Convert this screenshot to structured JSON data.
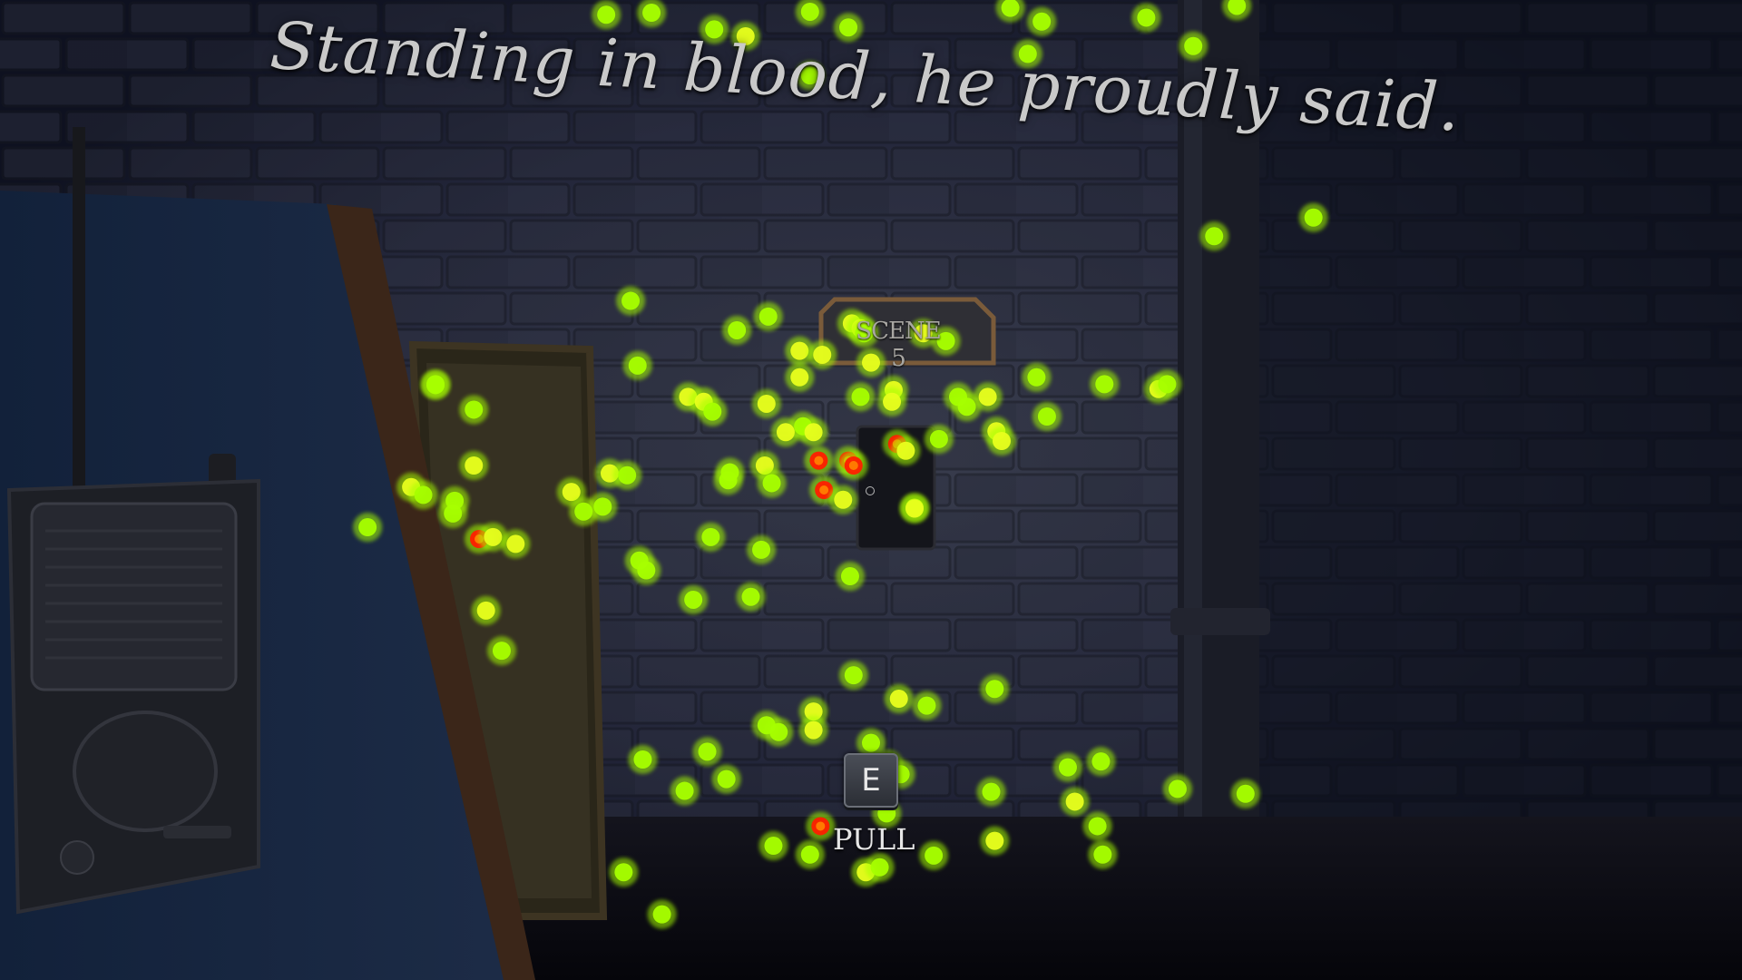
{
  "subtitle": "Standing in blood, he proudly said.",
  "sign": {
    "text": "SCENE 5"
  },
  "interaction_prompt": {
    "key": "E",
    "action": "PULL"
  },
  "heatmap": {
    "colors": {
      "low": "#a6ff00",
      "mid": "#e8ff1e",
      "high": "#ff1e00"
    },
    "points": [
      [
        0.348,
        0.015,
        0.5
      ],
      [
        0.374,
        0.013,
        0.5
      ],
      [
        0.41,
        0.03,
        0.5
      ],
      [
        0.428,
        0.037,
        0.6
      ],
      [
        0.465,
        0.012,
        0.5
      ],
      [
        0.487,
        0.028,
        0.5
      ],
      [
        0.465,
        0.077,
        0.5
      ],
      [
        0.58,
        0.008,
        0.5
      ],
      [
        0.598,
        0.022,
        0.5
      ],
      [
        0.658,
        0.018,
        0.5
      ],
      [
        0.685,
        0.047,
        0.5
      ],
      [
        0.71,
        0.006,
        0.5
      ],
      [
        0.59,
        0.055,
        0.5
      ],
      [
        0.697,
        0.241,
        0.5
      ],
      [
        0.754,
        0.222,
        0.5
      ],
      [
        0.362,
        0.307,
        0.5
      ],
      [
        0.423,
        0.337,
        0.5
      ],
      [
        0.441,
        0.323,
        0.5
      ],
      [
        0.366,
        0.373,
        0.5
      ],
      [
        0.25,
        0.392,
        0.5
      ],
      [
        0.272,
        0.418,
        0.5
      ],
      [
        0.459,
        0.358,
        0.6
      ],
      [
        0.459,
        0.385,
        0.6
      ],
      [
        0.472,
        0.362,
        0.6
      ],
      [
        0.489,
        0.33,
        0.6
      ],
      [
        0.494,
        0.335,
        0.6
      ],
      [
        0.496,
        0.34,
        0.5
      ],
      [
        0.5,
        0.37,
        0.6
      ],
      [
        0.513,
        0.398,
        0.7
      ],
      [
        0.53,
        0.34,
        0.6
      ],
      [
        0.543,
        0.348,
        0.5
      ],
      [
        0.512,
        0.41,
        0.6
      ],
      [
        0.494,
        0.405,
        0.5
      ],
      [
        0.395,
        0.405,
        0.6
      ],
      [
        0.404,
        0.41,
        0.6
      ],
      [
        0.409,
        0.42,
        0.5
      ],
      [
        0.44,
        0.412,
        0.6
      ],
      [
        0.461,
        0.435,
        0.5
      ],
      [
        0.418,
        0.49,
        0.5
      ],
      [
        0.439,
        0.475,
        0.6
      ],
      [
        0.451,
        0.441,
        0.6
      ],
      [
        0.467,
        0.441,
        0.7
      ],
      [
        0.47,
        0.47,
        0.9
      ],
      [
        0.473,
        0.5,
        0.8
      ],
      [
        0.487,
        0.47,
        0.9
      ],
      [
        0.49,
        0.475,
        0.8
      ],
      [
        0.484,
        0.51,
        0.6
      ],
      [
        0.515,
        0.453,
        0.8
      ],
      [
        0.52,
        0.46,
        0.6
      ],
      [
        0.525,
        0.518,
        0.6
      ],
      [
        0.539,
        0.448,
        0.5
      ],
      [
        0.55,
        0.405,
        0.5
      ],
      [
        0.555,
        0.415,
        0.5
      ],
      [
        0.567,
        0.405,
        0.6
      ],
      [
        0.572,
        0.44,
        0.6
      ],
      [
        0.575,
        0.45,
        0.6
      ],
      [
        0.595,
        0.385,
        0.5
      ],
      [
        0.601,
        0.425,
        0.5
      ],
      [
        0.634,
        0.392,
        0.5
      ],
      [
        0.665,
        0.397,
        0.6
      ],
      [
        0.67,
        0.392,
        0.5
      ],
      [
        0.443,
        0.493,
        0.5
      ],
      [
        0.419,
        0.482,
        0.5
      ],
      [
        0.35,
        0.483,
        0.6
      ],
      [
        0.36,
        0.485,
        0.5
      ],
      [
        0.328,
        0.502,
        0.6
      ],
      [
        0.335,
        0.522,
        0.5
      ],
      [
        0.346,
        0.517,
        0.5
      ],
      [
        0.25,
        0.393,
        0.5
      ],
      [
        0.236,
        0.497,
        0.6
      ],
      [
        0.243,
        0.505,
        0.5
      ],
      [
        0.261,
        0.511,
        0.5
      ],
      [
        0.26,
        0.524,
        0.5
      ],
      [
        0.272,
        0.475,
        0.6
      ],
      [
        0.275,
        0.55,
        0.8
      ],
      [
        0.283,
        0.548,
        0.6
      ],
      [
        0.296,
        0.555,
        0.6
      ],
      [
        0.211,
        0.538,
        0.5
      ],
      [
        0.279,
        0.623,
        0.7
      ],
      [
        0.288,
        0.664,
        0.5
      ],
      [
        0.367,
        0.572,
        0.5
      ],
      [
        0.371,
        0.582,
        0.5
      ],
      [
        0.408,
        0.548,
        0.5
      ],
      [
        0.437,
        0.561,
        0.5
      ],
      [
        0.398,
        0.612,
        0.5
      ],
      [
        0.431,
        0.609,
        0.5
      ],
      [
        0.488,
        0.588,
        0.5
      ],
      [
        0.525,
        0.519,
        0.6
      ],
      [
        0.49,
        0.689,
        0.5
      ],
      [
        0.516,
        0.713,
        0.6
      ],
      [
        0.532,
        0.72,
        0.5
      ],
      [
        0.571,
        0.703,
        0.5
      ],
      [
        0.467,
        0.726,
        0.6
      ],
      [
        0.467,
        0.745,
        0.6
      ],
      [
        0.44,
        0.74,
        0.5
      ],
      [
        0.447,
        0.747,
        0.5
      ],
      [
        0.406,
        0.767,
        0.5
      ],
      [
        0.417,
        0.795,
        0.5
      ],
      [
        0.369,
        0.775,
        0.5
      ],
      [
        0.393,
        0.807,
        0.5
      ],
      [
        0.5,
        0.758,
        0.5
      ],
      [
        0.51,
        0.78,
        0.5
      ],
      [
        0.517,
        0.79,
        0.5
      ],
      [
        0.509,
        0.83,
        0.5
      ],
      [
        0.471,
        0.843,
        0.9
      ],
      [
        0.465,
        0.872,
        0.5
      ],
      [
        0.444,
        0.863,
        0.5
      ],
      [
        0.497,
        0.89,
        0.6
      ],
      [
        0.505,
        0.885,
        0.5
      ],
      [
        0.536,
        0.873,
        0.5
      ],
      [
        0.571,
        0.858,
        0.7
      ],
      [
        0.569,
        0.808,
        0.5
      ],
      [
        0.613,
        0.783,
        0.5
      ],
      [
        0.617,
        0.818,
        0.7
      ],
      [
        0.632,
        0.777,
        0.5
      ],
      [
        0.63,
        0.843,
        0.5
      ],
      [
        0.633,
        0.872,
        0.5
      ],
      [
        0.676,
        0.805,
        0.5
      ],
      [
        0.715,
        0.81,
        0.5
      ],
      [
        0.358,
        0.89,
        0.5
      ],
      [
        0.38,
        0.933,
        0.5
      ]
    ]
  }
}
